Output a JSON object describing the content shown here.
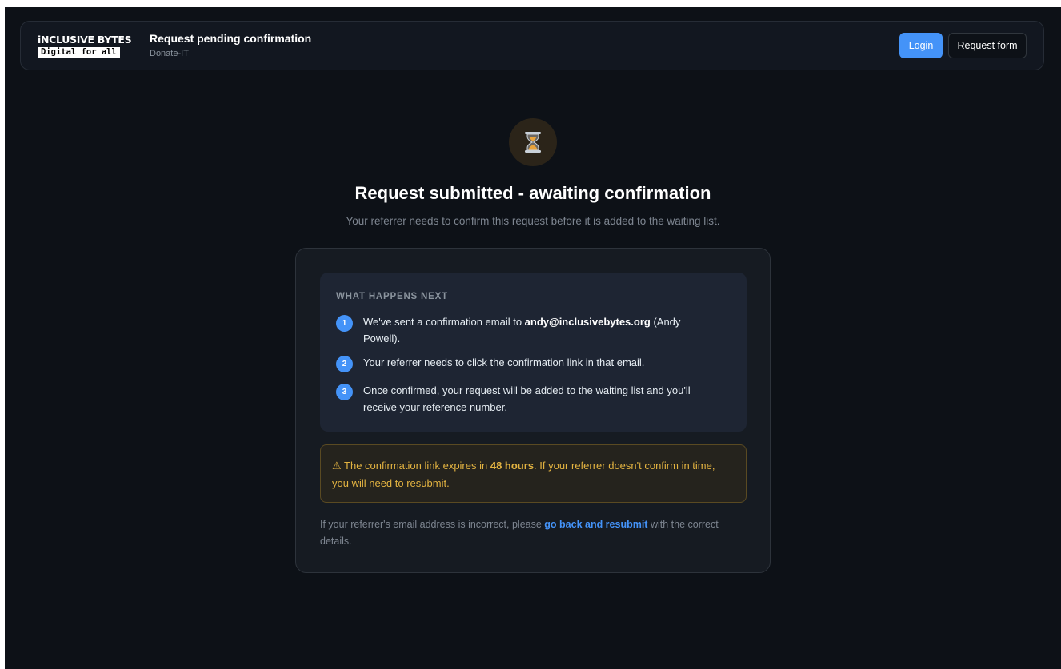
{
  "header": {
    "logo_line1": "iNCLUSIVE BYTES",
    "logo_line2": "Digital for all",
    "title": "Request pending confirmation",
    "subtitle": "Donate-IT",
    "login_label": "Login",
    "request_form_label": "Request form"
  },
  "hero": {
    "icon": "hourglass-icon",
    "title": "Request submitted - awaiting confirmation",
    "subtitle": "Your referrer needs to confirm this request before it is added to the waiting list."
  },
  "steps": {
    "heading": "WHAT HAPPENS NEXT",
    "items": [
      {
        "number": "1",
        "text_before": "We've sent a confirmation email to ",
        "email": "andy@inclusivebytes.org",
        "text_after": " (Andy Powell)."
      },
      {
        "number": "2",
        "text": "Your referrer needs to click the confirmation link in that email."
      },
      {
        "number": "3",
        "text": "Once confirmed, your request will be added to the waiting list and you'll receive your reference number."
      }
    ]
  },
  "warning": {
    "icon": "warning-icon",
    "icon_glyph": "⚠",
    "text_before": " The confirmation link expires in ",
    "duration": "48 hours",
    "text_after": ". If your referrer doesn't confirm in time, you will need to resubmit."
  },
  "footnote": {
    "text_before": "If your referrer's email address is incorrect, please ",
    "link_label": "go back and resubmit",
    "text_after": " with the correct details."
  },
  "colors": {
    "accent": "#4493f8",
    "background": "#0d1117",
    "warning": "#e3b341"
  }
}
